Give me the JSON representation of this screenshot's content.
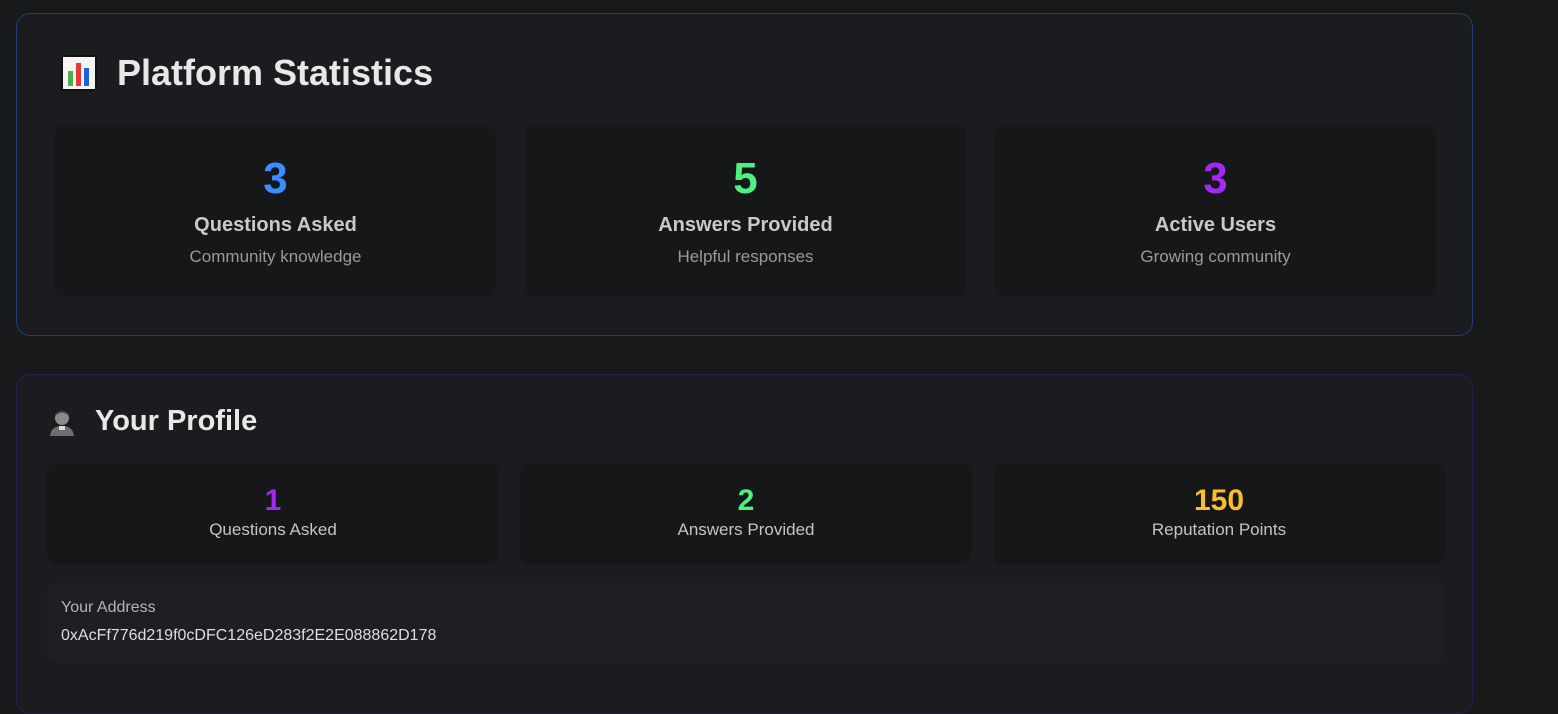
{
  "platform_stats": {
    "title": "Platform Statistics",
    "icon": "bar-chart-icon",
    "cards": [
      {
        "value": "3",
        "label": "Questions Asked",
        "sublabel": "Community knowledge",
        "color": "#3b8cff"
      },
      {
        "value": "5",
        "label": "Answers Provided",
        "sublabel": "Helpful responses",
        "color": "#4ef07f"
      },
      {
        "value": "3",
        "label": "Active Users",
        "sublabel": "Growing community",
        "color": "#a328f2"
      }
    ]
  },
  "profile": {
    "title": "Your Profile",
    "icon": "user-avatar-icon",
    "cards": [
      {
        "value": "1",
        "label": "Questions Asked",
        "color": "#a328f2"
      },
      {
        "value": "2",
        "label": "Answers Provided",
        "color": "#4ef07f"
      },
      {
        "value": "150",
        "label": "Reputation Points",
        "color": "#fbbf2e"
      }
    ],
    "address_label": "Your Address",
    "address": "0xAcFf776d219f0cDFC126eD283f2E2E088862D178"
  }
}
